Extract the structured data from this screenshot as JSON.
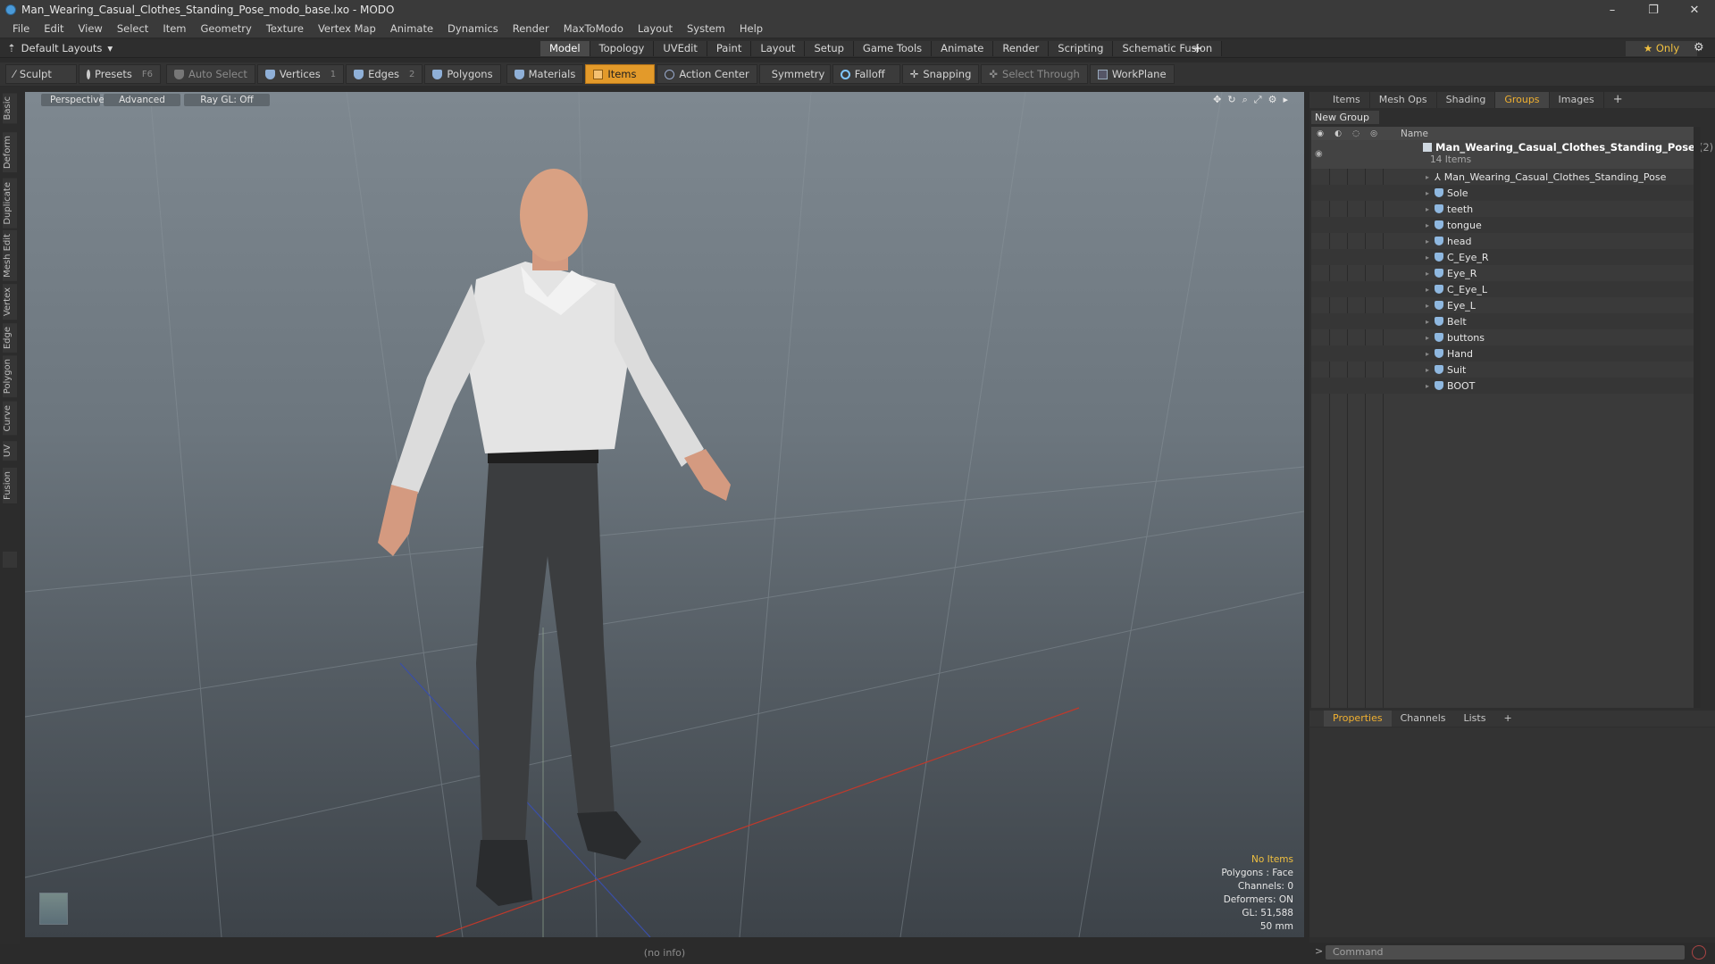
{
  "window": {
    "title": "Man_Wearing_Casual_Clothes_Standing_Pose_modo_base.lxo - MODO",
    "minimize": "–",
    "maximize": "❐",
    "close": "✕"
  },
  "menu": [
    "File",
    "Edit",
    "View",
    "Select",
    "Item",
    "Geometry",
    "Texture",
    "Vertex Map",
    "Animate",
    "Dynamics",
    "Render",
    "MaxToModo",
    "Layout",
    "System",
    "Help"
  ],
  "layout": {
    "selector": "Default Layouts",
    "tabs": [
      "Model",
      "Topology",
      "UVEdit",
      "Paint",
      "Layout",
      "Setup",
      "Game Tools",
      "Animate",
      "Render",
      "Scripting",
      "Schematic Fusion"
    ],
    "active_tab": "Model",
    "only_label": "Only"
  },
  "toolbar": {
    "sculpt": "Sculpt",
    "presets": "Presets",
    "presets_shortcut": "F6",
    "auto_select": "Auto Select",
    "vertices": "Vertices",
    "vertices_count": "1",
    "edges": "Edges",
    "edges_count": "2",
    "polygons": "Polygons",
    "materials": "Materials",
    "items": "Items",
    "action_center": "Action Center",
    "symmetry": "Symmetry",
    "falloff": "Falloff",
    "snapping": "Snapping",
    "select_through": "Select Through",
    "workplane": "WorkPlane"
  },
  "left_tabs": [
    "Basic",
    "Deform",
    "Duplicate",
    "Mesh Edit",
    "Vertex",
    "Edge",
    "Polygon",
    "Curve",
    "UV",
    "Fusion"
  ],
  "viewport": {
    "view": "Perspective",
    "shading": "Advanced",
    "raygl": "Ray GL: Off",
    "stats": {
      "selection": "No Items",
      "polygons": "Polygons : Face",
      "channels": "Channels: 0",
      "deformers": "Deformers: ON",
      "gl": "GL: 51,588",
      "scale": "50 mm"
    },
    "info": "(no info)"
  },
  "right_panel": {
    "tabs": [
      "Items",
      "Mesh Ops",
      "Shading",
      "Groups",
      "Images"
    ],
    "active_tab": "Groups",
    "new_group": "New Group",
    "name_header": "Name",
    "group": {
      "name": "Man_Wearing_Casual_Clothes_Standing_Pose",
      "count": "(2)",
      "sub": "14 Items"
    },
    "items": [
      "Man_Wearing_Casual_Clothes_Standing_Pose",
      "Sole",
      "teeth",
      "tongue",
      "head",
      "C_Eye_R",
      "Eye_R",
      "C_Eye_L",
      "Eye_L",
      "Belt",
      "buttons",
      "Hand",
      "Suit",
      "BOOT"
    ],
    "property_tabs": [
      "Properties",
      "Channels",
      "Lists"
    ],
    "active_property_tab": "Properties",
    "command_placeholder": "Command"
  }
}
